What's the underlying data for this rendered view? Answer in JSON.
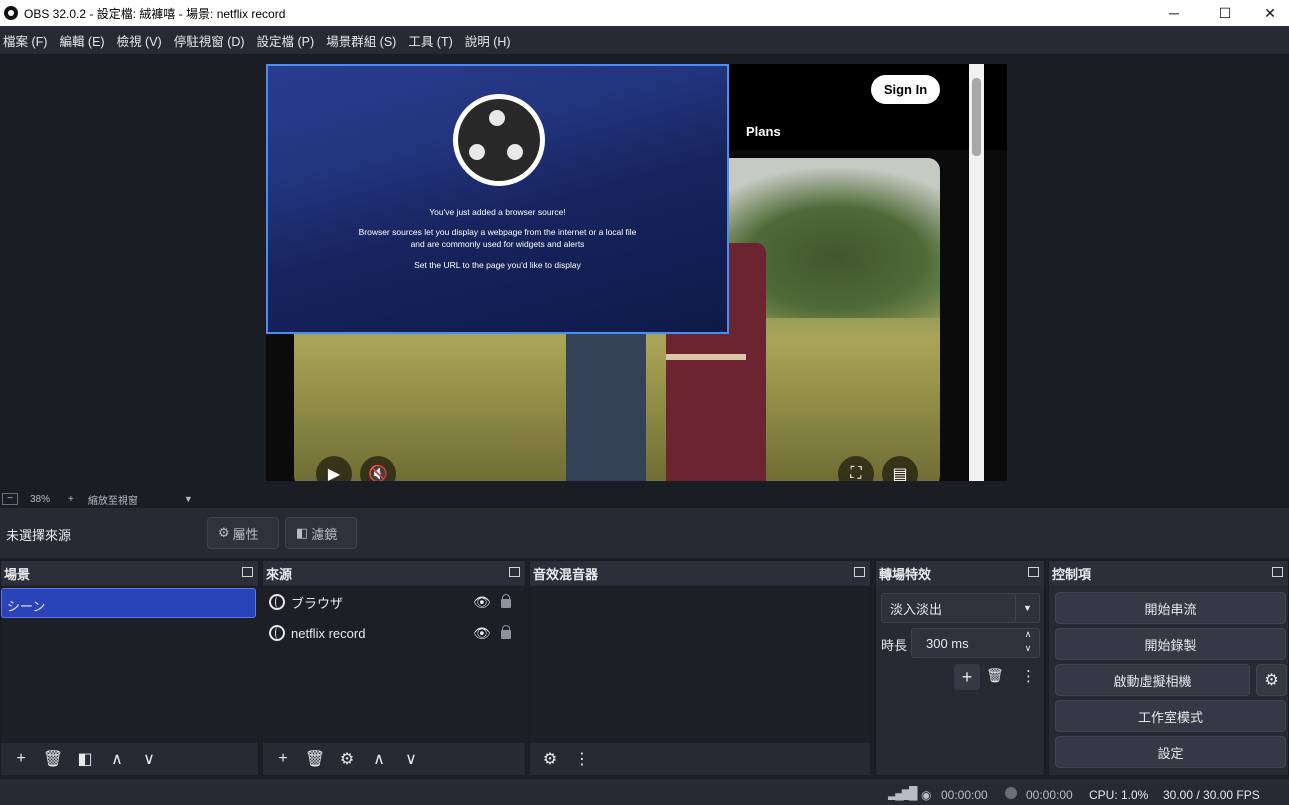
{
  "window": {
    "title": "OBS 32.0.2 - 設定檔: 絨褲嘻 - 場景: netflix record"
  },
  "menu": [
    "檔案 (F)",
    "編輯 (E)",
    "檢視 (V)",
    "停駐視窗 (D)",
    "設定檔 (P)",
    "場景群組 (S)",
    "工具 (T)",
    "說明 (H)"
  ],
  "preview": {
    "signin_label": "Sign In",
    "plans_label": "Plans",
    "browser_source": {
      "line1": "You've just added a browser source!",
      "line2": "Browser sources let you display a webpage from the internet or a local file",
      "line3": "and are commonly used for widgets and alerts",
      "line4": "Set the URL to the page you'd like to display"
    }
  },
  "zoom": {
    "minus": "−",
    "percent": "38%",
    "plus": "+",
    "mode": "縮放至視窗"
  },
  "source_toolbar": {
    "no_source": "未選擇來源",
    "properties": "屬性",
    "filters": "濾鏡"
  },
  "scenes": {
    "title": "場景",
    "items": [
      "シーン"
    ]
  },
  "sources": {
    "title": "來源",
    "items": [
      "ブラウザ",
      "netflix record"
    ]
  },
  "mixer": {
    "title": "音效混音器"
  },
  "transitions": {
    "title": "轉場特效",
    "selected": "淡入淡出",
    "duration_label": "時長",
    "duration_value": "300 ms"
  },
  "controls": {
    "title": "控制項",
    "start_stream": "開始串流",
    "start_record": "開始錄製",
    "virtual_cam": "啟動虛擬相機",
    "studio_mode": "工作室模式",
    "settings": "設定"
  },
  "status": {
    "stream_time": "00:00:00",
    "record_time": "00:00:00",
    "cpu": "CPU: 1.0%",
    "fps": "30.00 / 30.00 FPS"
  }
}
